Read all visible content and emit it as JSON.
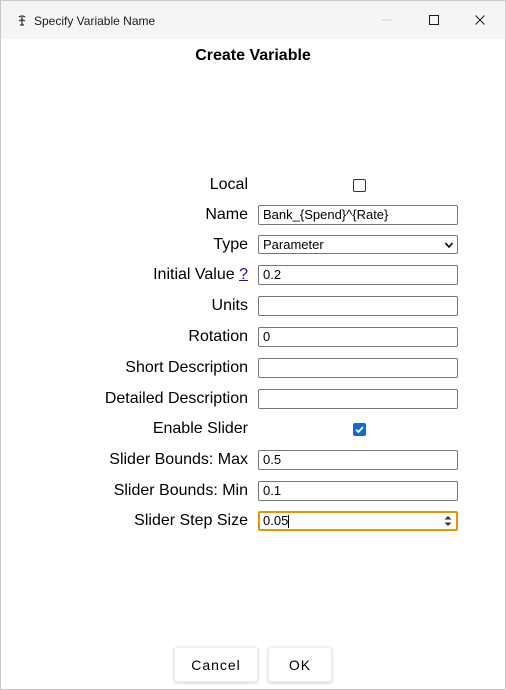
{
  "window": {
    "title": "Specify Variable Name"
  },
  "dialog": {
    "heading": "Create Variable"
  },
  "form": {
    "local_label": "Local",
    "local_checked": false,
    "name_label": "Name",
    "name_value": "Bank_{Spend}^{Rate}",
    "type_label": "Type",
    "type_value": "Parameter",
    "initial_value_label": "Initial Value",
    "initial_value_help": "?",
    "initial_value": "0.2",
    "units_label": "Units",
    "units_value": "",
    "rotation_label": "Rotation",
    "rotation_value": "0",
    "short_description_label": "Short Description",
    "short_description_value": "",
    "detailed_description_label": "Detailed Description",
    "detailed_description_value": "",
    "enable_slider_label": "Enable Slider",
    "enable_slider_checked": true,
    "slider_max_label": "Slider Bounds: Max",
    "slider_max_value": "0.5",
    "slider_min_label": "Slider Bounds: Min",
    "slider_min_value": "0.1",
    "slider_step_label": "Slider Step Size",
    "slider_step_value": "0.05"
  },
  "buttons": {
    "cancel": "Cancel",
    "ok": "OK"
  },
  "colors": {
    "accent": "#0b6dd8",
    "focus_border": "#e59700",
    "link": "#1a0dab"
  }
}
